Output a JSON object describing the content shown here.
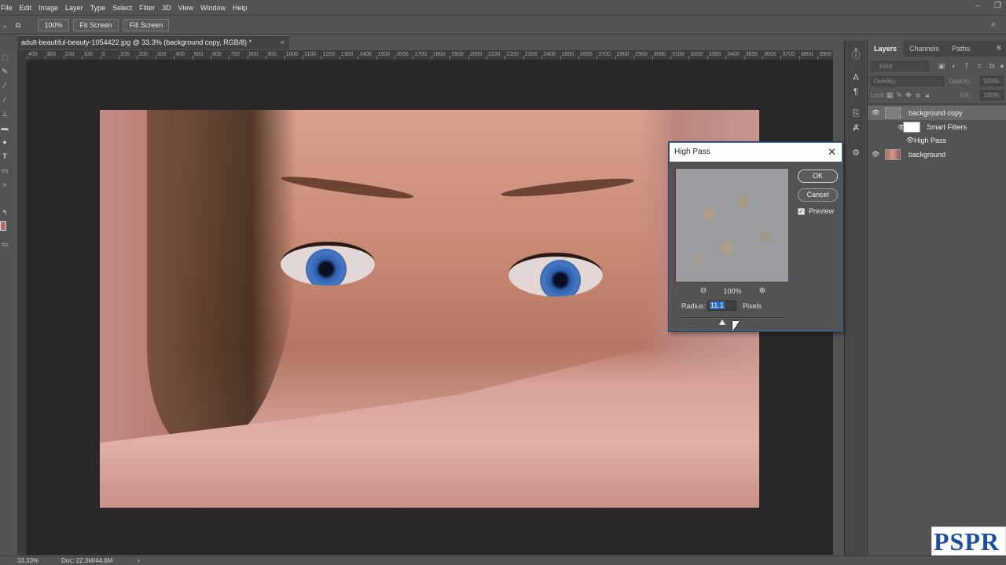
{
  "menu": [
    "File",
    "Edit",
    "Image",
    "Layer",
    "Type",
    "Select",
    "Filter",
    "3D",
    "View",
    "Window",
    "Help"
  ],
  "options_bar": {
    "zoom_btn": "100%",
    "fit_btn": "Fit Screen",
    "fill_btn": "Fill Screen"
  },
  "document": {
    "tab_title": "adult-beautiful-beauty-1054422.jpg @ 33.3% (background copy, RGB/8) *",
    "close_glyph": "×"
  },
  "ruler_ticks": [
    "400",
    "300",
    "200",
    "100",
    "0",
    "100",
    "200",
    "300",
    "400",
    "500",
    "600",
    "700",
    "800",
    "900",
    "1000",
    "1100",
    "1200",
    "1300",
    "1400",
    "1500",
    "1600",
    "1700",
    "1800",
    "1900",
    "2000",
    "2100",
    "2200",
    "2300",
    "2400",
    "2500",
    "2600",
    "2700",
    "2800",
    "2900",
    "3000",
    "3100",
    "3200",
    "3300",
    "3400",
    "3500",
    "3600",
    "3700",
    "3800",
    "3900"
  ],
  "dialog": {
    "title": "High Pass",
    "close_glyph": "✕",
    "ok": "OK",
    "cancel": "Cancel",
    "preview_label": "Preview",
    "preview_checked": true,
    "zoom_level": "100%",
    "radius_label": "Radius:",
    "radius_value": "11.1",
    "radius_unit": "Pixels",
    "slider_fraction": 0.4
  },
  "layers_panel": {
    "tabs": [
      "Layers",
      "Channels",
      "Paths"
    ],
    "active_tab": "Layers",
    "kind_placeholder": "Kind",
    "blend_mode": "Overlay",
    "opacity_label": "Opacity:",
    "opacity_value": "100%",
    "lock_label": "Lock:",
    "fill_label": "Fill:",
    "fill_value": "100%",
    "layers": [
      {
        "name": "background copy",
        "selected": true
      },
      {
        "name": "Smart Filters"
      },
      {
        "name": "High Pass"
      },
      {
        "name": "background"
      }
    ]
  },
  "status": {
    "zoom": "33.33%",
    "doc": "Doc: 22.3M/44.6M",
    "arrow": "›"
  },
  "watermark": "PSPR",
  "colors": {
    "accent": "#2f6cc2",
    "panel_bg": "#535353",
    "canvas_bg": "#282828"
  }
}
